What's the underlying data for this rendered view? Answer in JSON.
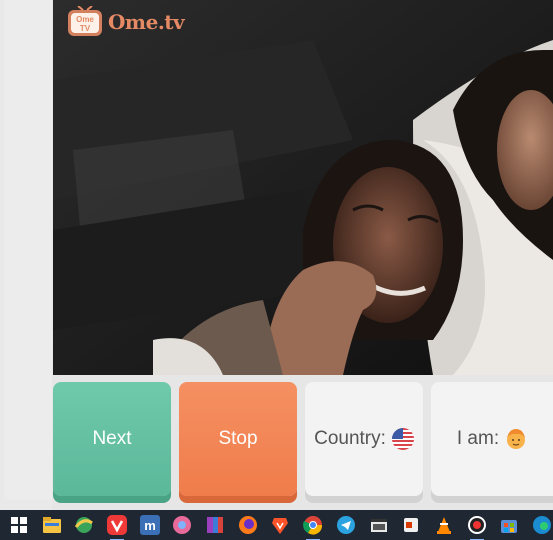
{
  "brand": {
    "name": "Ome",
    "suffix": ".tv",
    "badge_top": "Ome",
    "badge_bottom": "TV"
  },
  "controls": {
    "next_label": "Next",
    "stop_label": "Stop",
    "country_label": "Country:",
    "country_flag_icon": "us-flag-icon",
    "iam_label": "I am:",
    "iam_icon": "person-avatar-icon"
  },
  "colors": {
    "next": "#62bea0",
    "stop": "#f2834f",
    "neutral": "#f3f3f3",
    "taskbar": "#1f2733"
  },
  "taskbar": {
    "icons": [
      "windows-start-icon",
      "file-explorer-icon",
      "network-icon",
      "vivaldi-icon",
      "app-m-icon",
      "chromium-icon",
      "archive-icon",
      "firefox-icon",
      "brave-icon",
      "chrome-icon",
      "telegram-icon",
      "video-editor-icon",
      "office-icon",
      "vlc-icon",
      "recorder-icon",
      "store-icon",
      "edge-icon"
    ]
  }
}
